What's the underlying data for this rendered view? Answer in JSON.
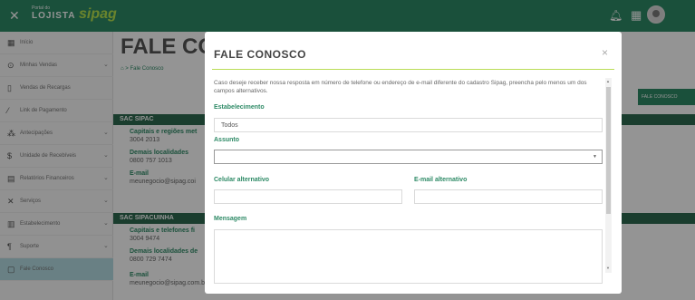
{
  "header": {
    "portal_label": "Portal do",
    "lojista_label": "LOJISTA",
    "brand_name": "sipag",
    "close_icon": "close-icon",
    "bell_icon": "bell-icon",
    "apps_icon": "grid-icon"
  },
  "sidebar": {
    "items": [
      {
        "label": "Início",
        "icon": "home-icon",
        "has_chevron": false
      },
      {
        "label": "Minhas Vendas",
        "icon": "dollar-circle-icon",
        "has_chevron": true
      },
      {
        "label": "Vendas de Recargas",
        "icon": "phone-icon",
        "has_chevron": false
      },
      {
        "label": "Link de Pagamento",
        "icon": "link-icon",
        "has_chevron": false
      },
      {
        "label": "Antecipações",
        "icon": "coins-icon",
        "has_chevron": true
      },
      {
        "label": "Unidade de Recebíveis",
        "icon": "dollar-icon",
        "has_chevron": true
      },
      {
        "label": "Relatórios Financeiros",
        "icon": "report-icon",
        "has_chevron": true
      },
      {
        "label": "Serviços",
        "icon": "tools-icon",
        "has_chevron": true
      },
      {
        "label": "Estabelecimento",
        "icon": "store-icon",
        "has_chevron": true
      },
      {
        "label": "Suporte",
        "icon": "support-icon",
        "has_chevron": true
      },
      {
        "label": "Fale Conosco",
        "icon": "chat-icon",
        "has_chevron": false
      }
    ]
  },
  "background": {
    "page_title": "FALE CONC",
    "breadcrumb": "⌂ > Fale Conosco",
    "action_button": "FALE CONOSCO",
    "sac_sipag": "SAC SIPAC",
    "capitais_label": "Capitais e regiões met",
    "capitais_phone": "3004 2013",
    "demais_label": "Demais localidades",
    "demais_phone": "0800 757 1013",
    "email_label": "E-mail",
    "email_value": "meunegocio@sipag.coi",
    "sac_sipacuinha": "SAC SIPACUINHA",
    "capitais2_label": "Capitais e telefones fi",
    "capitais2_phone": "3004 9474",
    "demais2_label": "Demais localidades de",
    "demais2_phone": "0800 729 7474",
    "email2_label": "E-mail",
    "email2_value": "meunegocio@sipag.com.br"
  },
  "modal": {
    "title": "FALE CONOSCO",
    "close_icon": "×",
    "intro": "Caso deseje receber nossa resposta em número de telefone ou endereço de e-mail diferente do cadastro Sipag, preencha pelo menos um dos campos alternativos.",
    "estabelecimento_label": "Estabelecimento",
    "estabelecimento_value": "Todos",
    "assunto_label": "Assunto",
    "assunto_value": "",
    "celular_label": "Celular alternativo",
    "celular_value": "",
    "email_label": "E-mail alternativo",
    "email_value": "",
    "mensagem_label": "Mensagem",
    "mensagem_value": ""
  },
  "colors": {
    "brand_green": "#2e8a66",
    "brand_lime": "#b7e34e",
    "active_sidebar": "#b5dde3"
  }
}
